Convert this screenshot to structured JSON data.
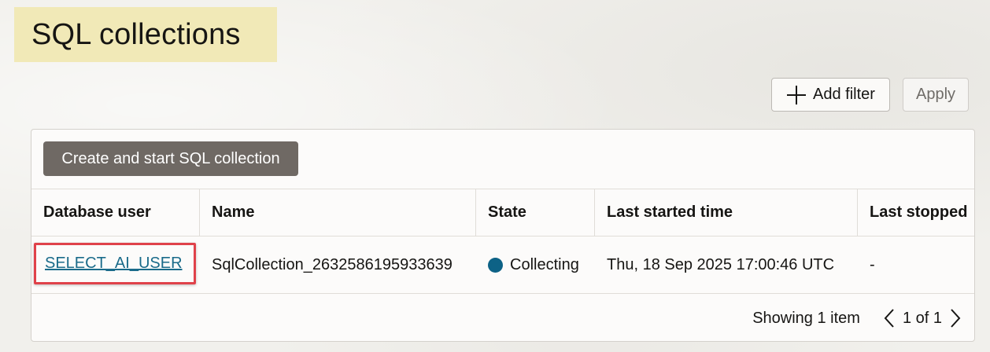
{
  "page": {
    "title": "SQL collections"
  },
  "toolbar": {
    "add_filter_label": "Add filter",
    "apply_label": "Apply"
  },
  "panel": {
    "create_button_label": "Create and start SQL collection",
    "columns": [
      "Database user",
      "Name",
      "State",
      "Last started time",
      "Last stopped"
    ],
    "rows": [
      {
        "database_user": "SELECT_AI_USER",
        "name": "SqlCollection_2632586195933639",
        "state": "Collecting",
        "last_started_time": "Thu, 18 Sep 2025 17:00:46 UTC",
        "last_stopped": "-"
      }
    ],
    "footer": {
      "count_text": "Showing 1 item",
      "page_text": "1 of 1"
    }
  },
  "colors": {
    "state_collecting": "#0d6286",
    "highlight_border": "#e0424a",
    "link": "#1a6b8a",
    "title_highlight": "#f1e9b7"
  },
  "icons": {
    "add": "plus-icon",
    "prev": "chevron-left-icon",
    "next": "chevron-right-icon",
    "state": "status-dot-icon"
  }
}
